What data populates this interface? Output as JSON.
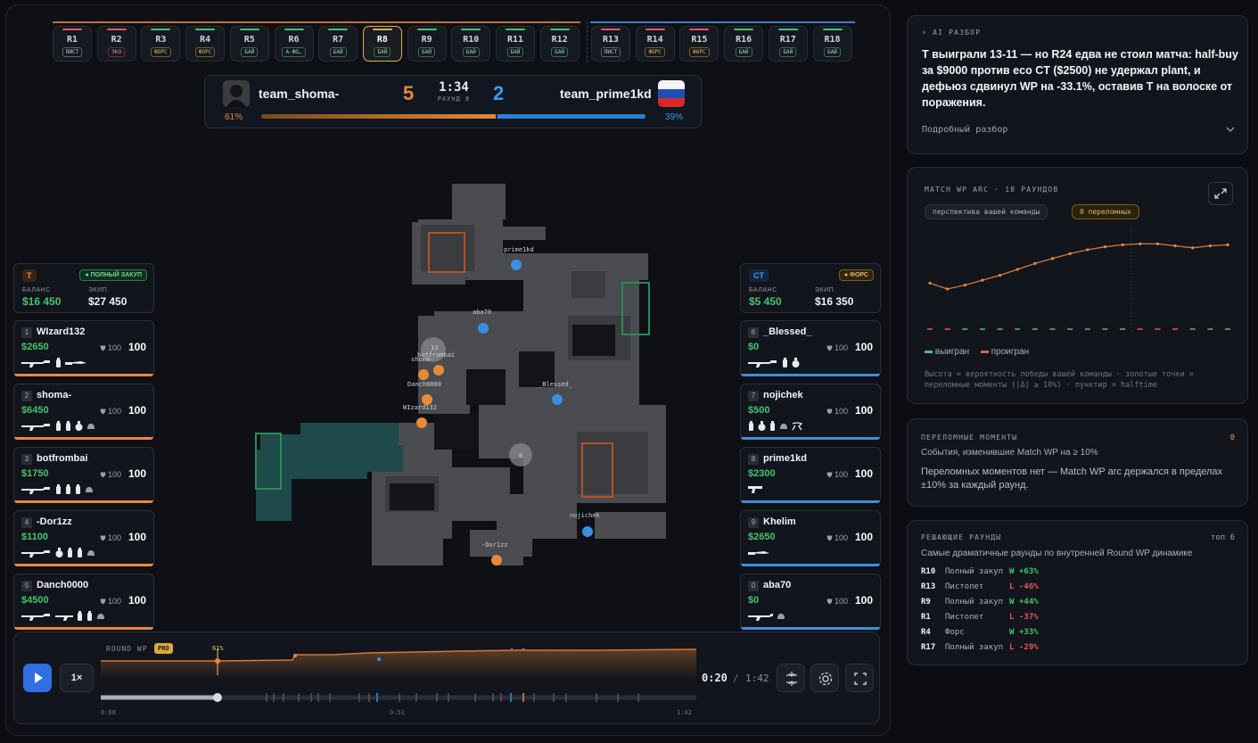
{
  "rounds": [
    {
      "label": "R1",
      "tag": "ПИСТ",
      "kind": "pistol",
      "winner": "red"
    },
    {
      "label": "R2",
      "tag": "ЭКО",
      "kind": "eco",
      "winner": "red"
    },
    {
      "label": "R3",
      "tag": "ФОРС",
      "kind": "force",
      "winner": "green"
    },
    {
      "label": "R4",
      "tag": "ФОРС",
      "kind": "force",
      "winner": "green"
    },
    {
      "label": "R5",
      "tag": "БАЙ",
      "kind": "buy",
      "winner": "green"
    },
    {
      "label": "R6",
      "tag": "А-ФО…",
      "kind": "buy",
      "winner": "green"
    },
    {
      "label": "R7",
      "tag": "БАЙ",
      "kind": "buy",
      "winner": "green"
    },
    {
      "label": "R8",
      "tag": "БАЙ",
      "kind": "buy",
      "winner": "active"
    },
    {
      "label": "R9",
      "tag": "БАЙ",
      "kind": "buy",
      "winner": "green"
    },
    {
      "label": "R10",
      "tag": "БАЙ",
      "kind": "buy",
      "winner": "green"
    },
    {
      "label": "R11",
      "tag": "БАЙ",
      "kind": "buy",
      "winner": "green"
    },
    {
      "label": "R12",
      "tag": "БАЙ",
      "kind": "buy",
      "winner": "green"
    },
    {
      "label": "R13",
      "tag": "ПИСТ",
      "kind": "pistol",
      "winner": "red"
    },
    {
      "label": "R14",
      "tag": "ФОРС",
      "kind": "force",
      "winner": "red"
    },
    {
      "label": "R15",
      "tag": "ФОРС",
      "kind": "force",
      "winner": "red"
    },
    {
      "label": "R16",
      "tag": "БАЙ",
      "kind": "buy",
      "winner": "green"
    },
    {
      "label": "R17",
      "tag": "БАЙ",
      "kind": "buy",
      "winner": "green"
    },
    {
      "label": "R18",
      "tag": "БАЙ",
      "kind": "buy",
      "winner": "green"
    }
  ],
  "scoreboard": {
    "team_t": "team_shoma-",
    "team_ct": "team_prime1kd",
    "score_t": "5",
    "score_ct": "2",
    "clock": "1:34",
    "round_label": "РАУНД 8",
    "wp_t": "61%",
    "wp_ct": "39%",
    "wp_t_value": 0.61
  },
  "t_team": {
    "side": "T",
    "buy": "ПОЛНЫЙ ЗАКУП",
    "balance_label": "БАЛАНС",
    "balance": "$16 450",
    "equip_label": "ЭКИП.",
    "equip": "$27 450",
    "players": [
      {
        "idx": "1",
        "name": "WIzard132",
        "money": "$2650",
        "armor": "100",
        "hp": "100"
      },
      {
        "idx": "2",
        "name": "shoma-",
        "money": "$6450",
        "armor": "100",
        "hp": "100"
      },
      {
        "idx": "3",
        "name": "botfrombai",
        "money": "$1750",
        "armor": "100",
        "hp": "100"
      },
      {
        "idx": "4",
        "name": "-Dor1zz",
        "money": "$1100",
        "armor": "100",
        "hp": "100"
      },
      {
        "idx": "5",
        "name": "Danch0000",
        "money": "$4500",
        "armor": "100",
        "hp": "100"
      }
    ]
  },
  "ct_team": {
    "side": "CT",
    "buy": "ФОРС",
    "balance_label": "БАЛАНС",
    "balance": "$5 450",
    "equip_label": "ЭКИП.",
    "equip": "$16 350",
    "players": [
      {
        "idx": "6",
        "name": "_Blessed_",
        "money": "$0",
        "armor": "100",
        "hp": "100"
      },
      {
        "idx": "7",
        "name": "nojichek",
        "money": "$500",
        "armor": "100",
        "hp": "100"
      },
      {
        "idx": "8",
        "name": "prime1kd",
        "money": "$2300",
        "armor": "100",
        "hp": "100"
      },
      {
        "idx": "9",
        "name": "Khelim",
        "money": "$2650",
        "armor": "100",
        "hp": "100"
      },
      {
        "idx": "0",
        "name": "aba70",
        "money": "$0",
        "armor": "100",
        "hp": "100"
      }
    ]
  },
  "map_labels": {
    "prime": "prime1kd",
    "aba": "aba70",
    "bot": "botfrombai",
    "shoma": "shoma-",
    "danch": "Danch0000",
    "wizard": "WIzard132",
    "blessed": "_Blessed_",
    "nojichek": "nojichek",
    "dorizz": "-Dor1zz",
    "smoke1": "13",
    "smoke2": "6"
  },
  "timeline": {
    "label": "ROUND WP",
    "pro": "PRO",
    "marker_pct": "61%",
    "speed": "1×",
    "current": "0:20",
    "separator": "/",
    "duration": "1:42",
    "tick_start": "0:00",
    "tick_mid": "0:51",
    "tick_end": "1:42",
    "progress": 0.196
  },
  "ai": {
    "title": "AI РАЗБОР",
    "summary": "T выиграли 13-11 — но R24 едва не стоил матча: half-buy за $9000 против eco CT ($2500) не удержал plant, и дефьюз сдвинул WP на -33.1%, оставив T на волоске от поражения.",
    "details": "Подробный разбор"
  },
  "arc": {
    "title": "MATCH WP ARC · 18 РАУНДОВ",
    "pill1": "перспектива вашей команды",
    "pill2": "0 переломных",
    "legend_win": "выигран",
    "legend_loss": "проигран",
    "note": "Высота = вероятность победы вашей команды · золотые точки = переломные моменты (|Δ| ≥ 10%) · пунктир = halftime"
  },
  "chart_data": {
    "type": "line",
    "title": "MATCH WP ARC · 18 РАУНДОВ",
    "x": [
      1,
      2,
      3,
      4,
      5,
      6,
      7,
      8,
      9,
      10,
      11,
      12,
      13,
      14,
      15,
      16,
      17,
      18
    ],
    "series": [
      {
        "values": [
          0.46,
          0.4,
          0.44,
          0.49,
          0.54,
          0.6,
          0.66,
          0.71,
          0.76,
          0.8,
          0.83,
          0.85,
          0.86,
          0.86,
          0.84,
          0.82,
          0.84,
          0.85
        ]
      }
    ],
    "results": [
      "L",
      "L",
      "W",
      "W",
      "W",
      "W",
      "W",
      "W",
      "W",
      "W",
      "W",
      "W",
      "L",
      "L",
      "L",
      "W",
      "W",
      "W"
    ],
    "ylim": [
      0,
      1
    ]
  },
  "turning": {
    "title": "ПЕРЕЛОМНЫЕ МОМЕНТЫ",
    "count": "0",
    "subtitle": "События, изменившие Match WP на ≥ 10%",
    "empty": "Переломных моментов нет — Match WP arc держался в пределах ±10% за каждый раунд."
  },
  "decisive": {
    "title": "РЕШАЮЩИЕ РАУНДЫ",
    "top": "топ 6",
    "subtitle": "Самые драматичные раунды по внутренней Round WP динамике",
    "rows": [
      {
        "round": "R10",
        "type": "Полный закуп",
        "result": "W",
        "delta": "+63%"
      },
      {
        "round": "R13",
        "type": "Пистолет",
        "result": "L",
        "delta": "-46%"
      },
      {
        "round": "R9",
        "type": "Полный закуп",
        "result": "W",
        "delta": "+44%"
      },
      {
        "round": "R1",
        "type": "Пистолет",
        "result": "L",
        "delta": "-37%"
      },
      {
        "round": "R4",
        "type": "Форс",
        "result": "W",
        "delta": "+33%"
      },
      {
        "round": "R17",
        "type": "Полный закуп",
        "result": "L",
        "delta": "-29%"
      }
    ]
  },
  "colors": {
    "t": "#e8893a",
    "ct": "#3a8fe0",
    "win": "#46c36e",
    "loss": "#e05a5a",
    "gold": "#d8a845"
  }
}
